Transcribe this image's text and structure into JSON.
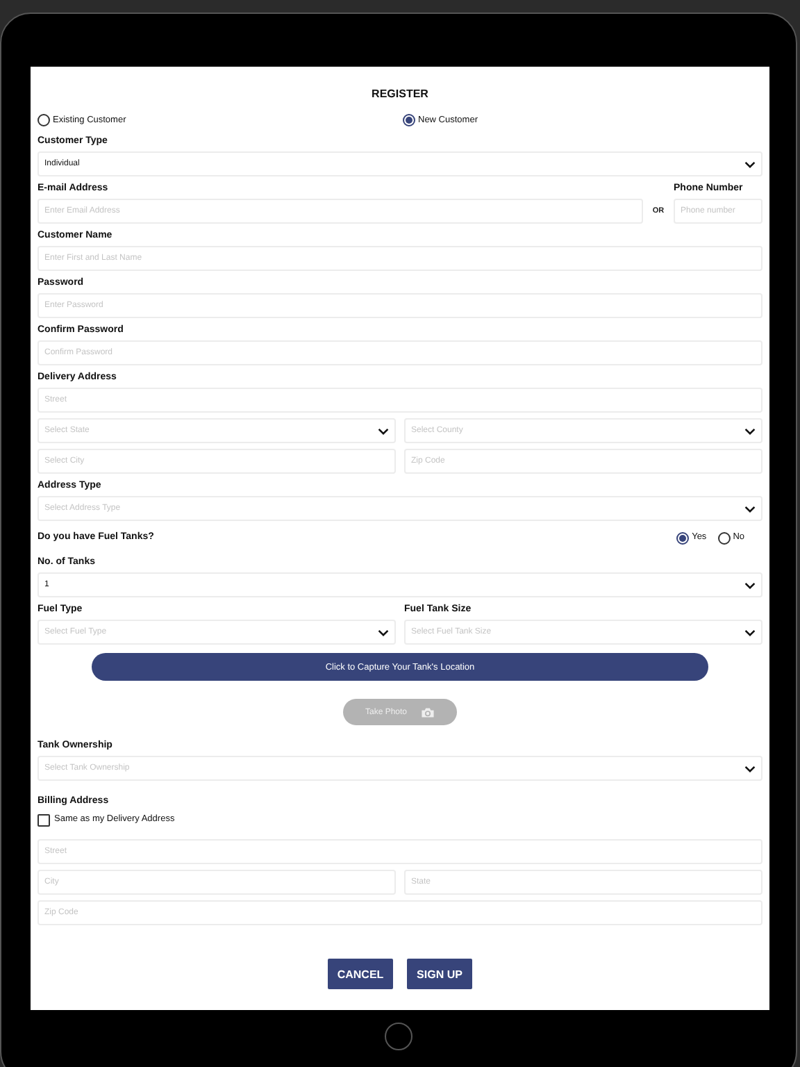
{
  "title": "REGISTER",
  "customer_options": [
    {
      "label": "Existing Customer",
      "selected": false
    },
    {
      "label": "New Customer",
      "selected": true
    }
  ],
  "rows": [
    {
      "kind": "label",
      "text": "Customer Type"
    },
    {
      "kind": "fields",
      "fields": [
        {
          "kind": "select",
          "value": "Individual"
        }
      ]
    },
    {
      "kind": "email_phone",
      "email_label": "E-mail Address",
      "email_placeholder": "Enter Email Address",
      "or": "OR",
      "phone_label": "Phone Number",
      "phone_placeholder": "Phone number"
    },
    {
      "kind": "label",
      "text": "Customer Name"
    },
    {
      "kind": "fields",
      "fields": [
        {
          "kind": "input",
          "placeholder": "Enter First and Last Name"
        }
      ]
    },
    {
      "kind": "label",
      "text": "Password"
    },
    {
      "kind": "fields",
      "fields": [
        {
          "kind": "input",
          "placeholder": "Enter Password"
        }
      ]
    },
    {
      "kind": "label",
      "text": "Confirm Password"
    },
    {
      "kind": "fields",
      "fields": [
        {
          "kind": "input",
          "placeholder": "Confirm Password"
        }
      ]
    },
    {
      "kind": "label",
      "text": "Delivery Address"
    },
    {
      "kind": "fields",
      "fields": [
        {
          "kind": "input",
          "placeholder": "Street"
        }
      ]
    },
    {
      "kind": "fields",
      "fields": [
        {
          "kind": "select",
          "placeholder": "Select State"
        },
        {
          "kind": "select",
          "placeholder": "Select County"
        }
      ]
    },
    {
      "kind": "fields",
      "fields": [
        {
          "kind": "input",
          "placeholder": "Select City"
        },
        {
          "kind": "input",
          "placeholder": "Zip Code"
        }
      ]
    },
    {
      "kind": "label",
      "text": "Address Type"
    },
    {
      "kind": "fields",
      "fields": [
        {
          "kind": "select",
          "placeholder": "Select Address Type"
        }
      ]
    },
    {
      "kind": "question",
      "text": "Do you have Fuel Tanks?",
      "options": [
        {
          "label": "Yes",
          "selected": true
        },
        {
          "label": "No",
          "selected": false
        }
      ]
    },
    {
      "kind": "label",
      "text": "No. of Tanks"
    },
    {
      "kind": "fields",
      "fields": [
        {
          "kind": "select",
          "value": "1"
        }
      ]
    },
    {
      "kind": "labels",
      "texts": [
        "Fuel Type",
        "Fuel Tank Size"
      ]
    },
    {
      "kind": "fields",
      "fields": [
        {
          "kind": "select",
          "placeholder": "Select Fuel Type"
        },
        {
          "kind": "select",
          "placeholder": "Select Fuel Tank Size"
        }
      ]
    },
    {
      "kind": "primary_button",
      "text": "Click to Capture Your Tank's Location"
    },
    {
      "kind": "photo_button",
      "text": "Take Photo",
      "disabled": true
    },
    {
      "kind": "label",
      "text": "Tank Ownership"
    },
    {
      "kind": "fields",
      "fields": [
        {
          "kind": "select",
          "placeholder": "Select Tank Ownership"
        }
      ]
    },
    {
      "kind": "label",
      "text": "Billing Address"
    },
    {
      "kind": "checkbox",
      "text": "Same as my Delivery Address",
      "checked": false
    },
    {
      "kind": "fields",
      "fields": [
        {
          "kind": "input",
          "placeholder": "Street"
        }
      ]
    },
    {
      "kind": "fields",
      "fields": [
        {
          "kind": "input",
          "placeholder": "City"
        },
        {
          "kind": "input",
          "placeholder": "State"
        }
      ]
    },
    {
      "kind": "fields",
      "fields": [
        {
          "kind": "input",
          "placeholder": "Zip Code"
        }
      ]
    },
    {
      "kind": "actions",
      "buttons": [
        "CANCEL",
        "SIGN UP"
      ]
    }
  ]
}
